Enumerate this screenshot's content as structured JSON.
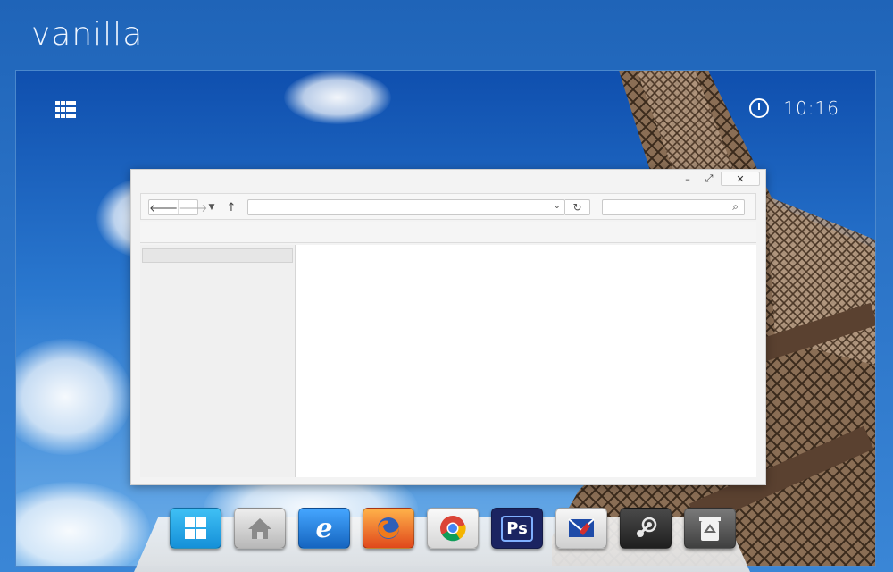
{
  "desktop": {
    "brand": "vanilla",
    "clock": "10:16"
  },
  "window": {
    "controls": {
      "minimize": "–",
      "maximize": "⤢",
      "close": "✕"
    },
    "toolbar": {
      "back": "🡐",
      "forward": "🡒",
      "dropdown": "▼",
      "up": "↑",
      "address_value": "",
      "address_chevron": "⌄",
      "refresh": "↻",
      "search_value": "",
      "search_icon": "⌕"
    }
  },
  "dock": {
    "icons": [
      {
        "name": "windows-start-icon",
        "color": "#22a7e8"
      },
      {
        "name": "home-folder-icon",
        "color": "#bdbdbd"
      },
      {
        "name": "internet-explorer-icon",
        "color": "#1e88e5"
      },
      {
        "name": "firefox-icon",
        "color": "#f05a1a"
      },
      {
        "name": "chrome-icon",
        "color": "#e8e8e8"
      },
      {
        "name": "photoshop-icon",
        "color": "#1f2a6b"
      },
      {
        "name": "mail-icon",
        "color": "#e0e0e0"
      },
      {
        "name": "steam-icon",
        "color": "#2f2f2f"
      },
      {
        "name": "recycle-bin-icon",
        "color": "#5c5c5c"
      }
    ],
    "photoshop_label": "Ps",
    "ie_label": "e"
  },
  "colors": {
    "sky": "#2a72c6",
    "window_bg": "#f3f3f3",
    "accent": "#1e88e5"
  }
}
